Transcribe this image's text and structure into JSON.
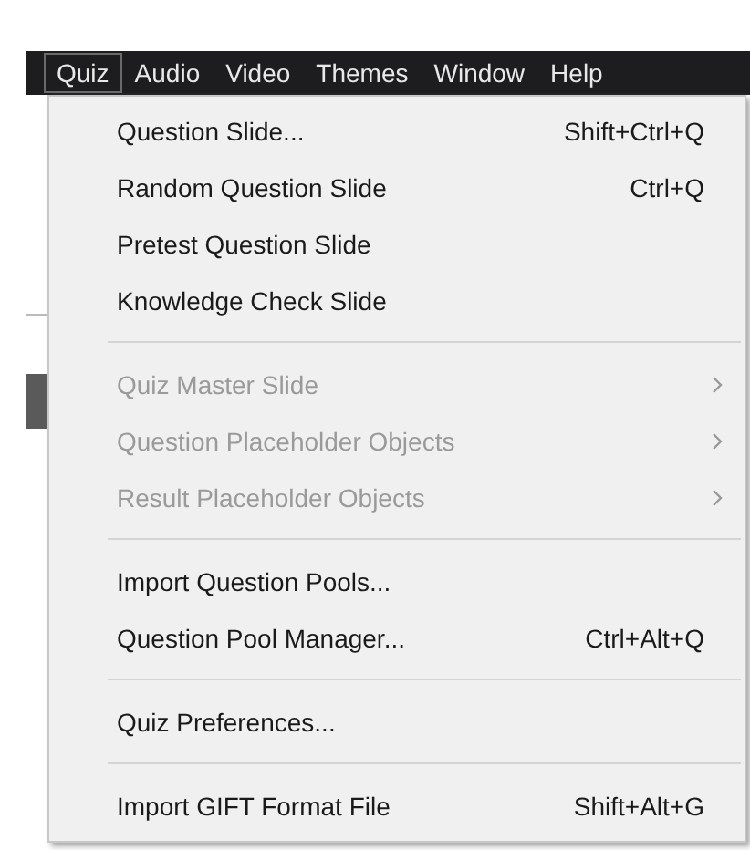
{
  "menubar": [
    {
      "label": "Quiz",
      "selected": true
    },
    {
      "label": "Audio",
      "selected": false
    },
    {
      "label": "Video",
      "selected": false
    },
    {
      "label": "Themes",
      "selected": false
    },
    {
      "label": "Window",
      "selected": false
    },
    {
      "label": "Help",
      "selected": false
    }
  ],
  "menu": [
    {
      "kind": "item",
      "label": "Question Slide...",
      "shortcut": "Shift+Ctrl+Q",
      "disabled": false,
      "submenu": false
    },
    {
      "kind": "item",
      "label": "Random Question Slide",
      "shortcut": "Ctrl+Q",
      "disabled": false,
      "submenu": false
    },
    {
      "kind": "item",
      "label": "Pretest Question Slide",
      "disabled": false,
      "submenu": false
    },
    {
      "kind": "item",
      "label": "Knowledge Check Slide",
      "disabled": false,
      "submenu": false
    },
    {
      "kind": "separator"
    },
    {
      "kind": "item",
      "label": "Quiz Master Slide",
      "disabled": true,
      "submenu": true
    },
    {
      "kind": "item",
      "label": "Question Placeholder Objects",
      "disabled": true,
      "submenu": true
    },
    {
      "kind": "item",
      "label": "Result Placeholder Objects",
      "disabled": true,
      "submenu": true
    },
    {
      "kind": "separator"
    },
    {
      "kind": "item",
      "label": "Import Question Pools...",
      "disabled": false,
      "submenu": false
    },
    {
      "kind": "item",
      "label": "Question Pool Manager...",
      "shortcut": "Ctrl+Alt+Q",
      "disabled": false,
      "submenu": false
    },
    {
      "kind": "separator"
    },
    {
      "kind": "item",
      "label": "Quiz Preferences...",
      "disabled": false,
      "submenu": false
    },
    {
      "kind": "separator"
    },
    {
      "kind": "item",
      "label": "Import GIFT Format File",
      "shortcut": "Shift+Alt+G",
      "disabled": false,
      "submenu": false
    }
  ]
}
